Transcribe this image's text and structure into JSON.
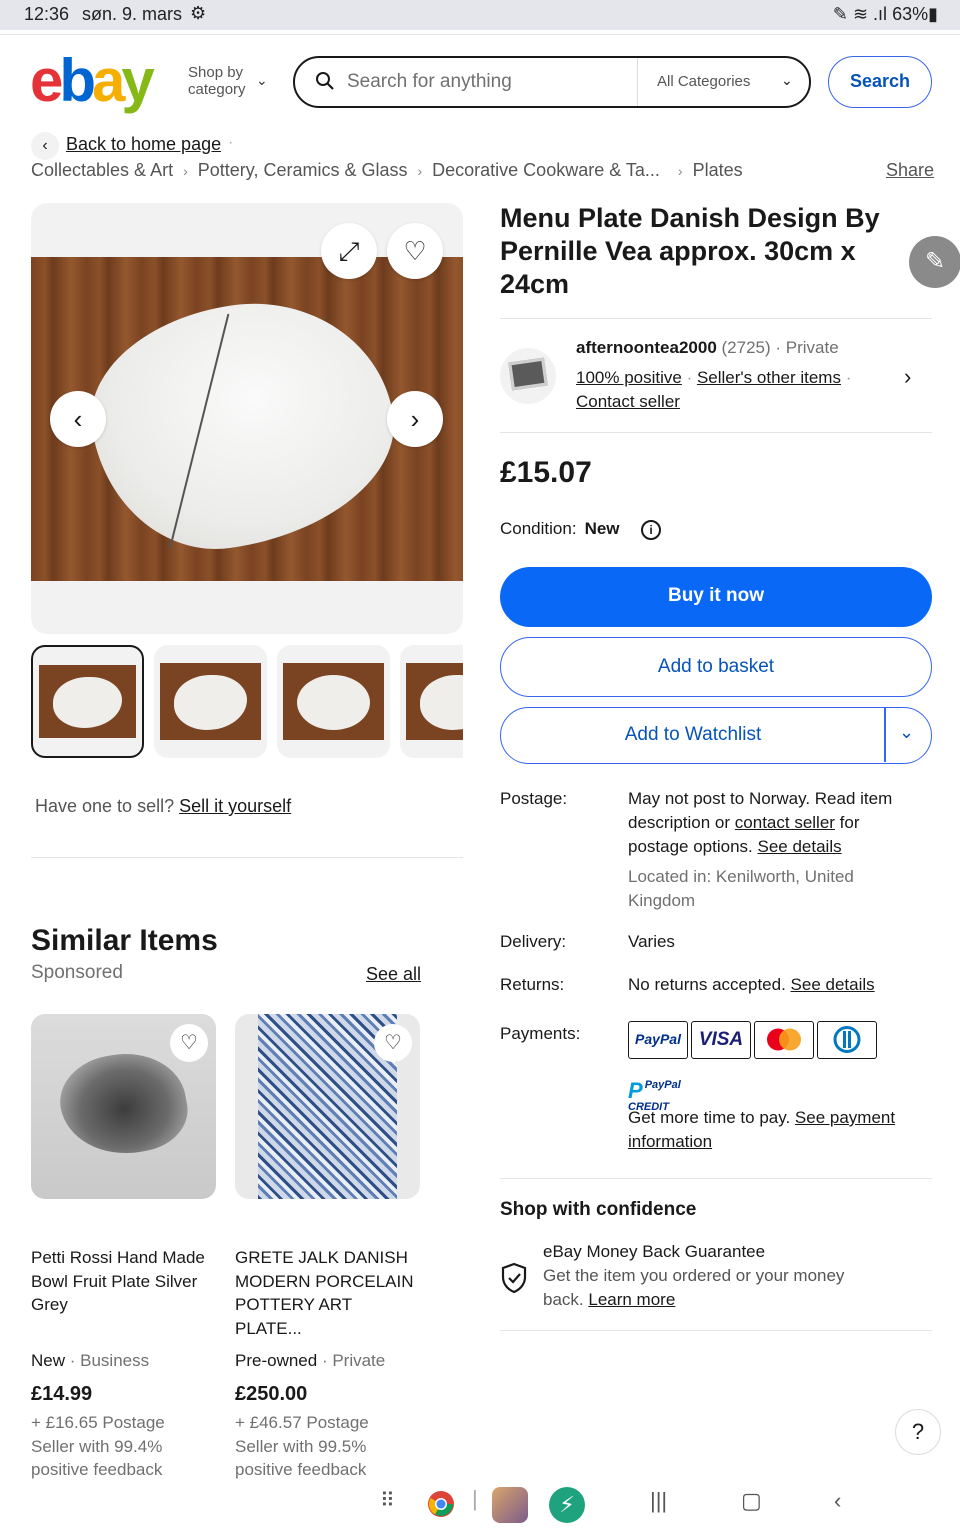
{
  "status_bar": {
    "time": "12:36",
    "date": "søn. 9. mars",
    "battery": "63%"
  },
  "header": {
    "logo": {
      "e": "e",
      "b": "b",
      "a": "a",
      "y": "y"
    },
    "shop_by_line1": "Shop by",
    "shop_by_line2": "category",
    "search_placeholder": "Search for anything",
    "category_select": "All Categories",
    "search_button": "Search"
  },
  "breadcrumb": {
    "back": "Back to home page",
    "items": [
      "Collectables & Art",
      "Pottery, Ceramics & Glass",
      "Decorative Cookware & Ta...",
      "Plates"
    ],
    "share": "Share"
  },
  "gallery": {
    "thumbnail_count": 4,
    "selected_index": 0
  },
  "sell": {
    "prefix": "Have one to sell?",
    "link": "Sell it yourself"
  },
  "similar": {
    "title": "Similar Items",
    "sponsored": "Sponsored",
    "see_all": "See all",
    "items": [
      {
        "title": "Petti Rossi Hand Made Bowl Fruit Plate Silver Grey",
        "condition": "New",
        "seller_type": " · Business",
        "price": "£14.99",
        "postage": "+ £16.65 Postage",
        "feedback": "Seller with 99.4% positive feedback"
      },
      {
        "title": "GRETE JALK DANISH MODERN PORCELAIN POTTERY ART PLATE...",
        "condition": "Pre-owned",
        "seller_type": " · Private",
        "price": "£250.00",
        "postage": "+ £46.57 Postage",
        "feedback": "Seller with 99.5% positive feedback"
      }
    ]
  },
  "product": {
    "title": "Menu Plate Danish Design By Pernille Vea approx. 30cm x 24cm",
    "seller": {
      "name": "afternoontea2000",
      "score": " (2725)",
      "type": " · Private",
      "positive": "100% positive",
      "other_items": "Seller's other items",
      "contact": "Contact seller"
    },
    "price": "£15.07",
    "condition_label": "Condition:",
    "condition_value": "New",
    "buy_now": "Buy it now",
    "add_to_basket": "Add to basket",
    "add_to_watchlist": "Add to Watchlist",
    "postage_label": "Postage:",
    "postage_text1": "May not post to Norway. Read item description or ",
    "postage_link1": "contact seller",
    "postage_text2": " for postage options. ",
    "postage_link2": "See details",
    "located": "Located in: Kenilworth, United Kingdom",
    "delivery_label": "Delivery:",
    "delivery_value": "Varies",
    "returns_label": "Returns:",
    "returns_value": "No returns accepted. ",
    "returns_link": "See details",
    "payments_label": "Payments:",
    "pay_cards": {
      "paypal": "PayPal",
      "visa": "VISA"
    },
    "paypal_credit_1": "PayPal",
    "paypal_credit_2": "CREDIT",
    "pay_text": "Get more time to pay. ",
    "pay_link": "See payment information",
    "confidence_title": "Shop with confidence",
    "guarantee_title": "eBay Money Back Guarantee",
    "guarantee_text": "Get the item you ordered or your money back. ",
    "learn_more": "Learn more"
  },
  "help": "?",
  "colors": {
    "primary": "#0968f6",
    "link_blue": "#0654ba",
    "outline_blue": "#3665f3"
  }
}
